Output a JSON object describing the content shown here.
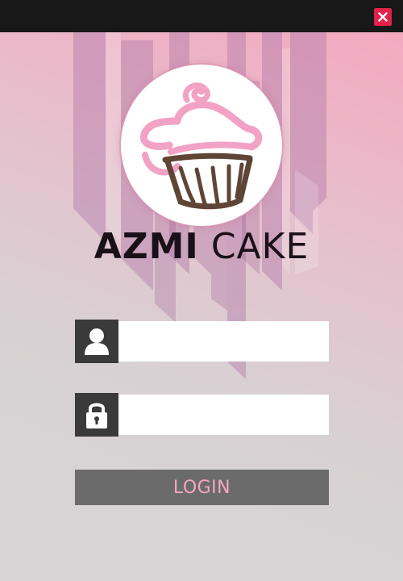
{
  "window": {
    "close_icon": "close-icon",
    "close_color": "#e3214a",
    "titlebar_color": "#181818"
  },
  "branding": {
    "name_bold": "AZMI",
    "name_light": "CAKE",
    "logo_icon": "cupcake-icon",
    "logo_colors": {
      "frosting": "#f2a2c4",
      "cup": "#5e4535"
    }
  },
  "form": {
    "username": {
      "icon": "user-icon",
      "value": "",
      "placeholder": ""
    },
    "password": {
      "icon": "lock-icon",
      "value": "",
      "placeholder": ""
    },
    "login_label": "LOGIN"
  },
  "colors": {
    "accent_pink": "#f5a6c3",
    "icon_box": "#3a3a3a",
    "button_bg": "#6b6b6b"
  }
}
